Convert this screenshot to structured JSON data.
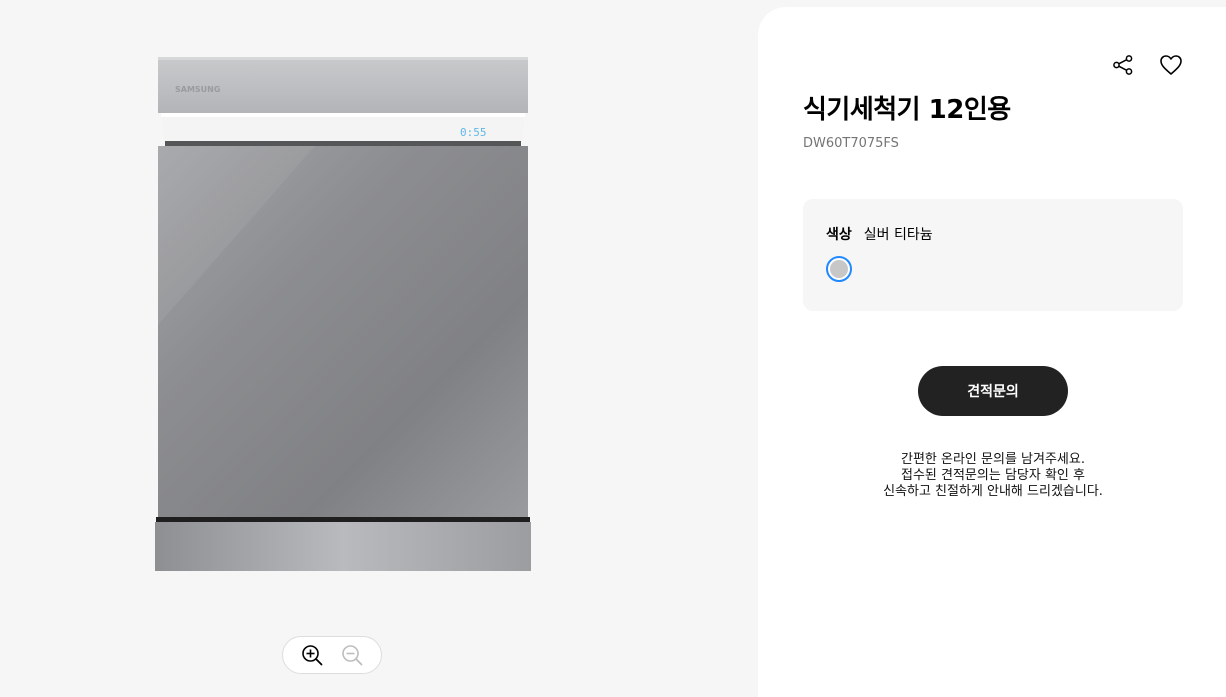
{
  "gallery": {
    "product_image": {
      "brand_text": "SAMSUNG",
      "display_text": "0:55"
    },
    "zoom": {
      "zoom_in_icon": "zoom-in-icon",
      "zoom_out_icon": "zoom-out-icon"
    }
  },
  "panel": {
    "actions": {
      "share_icon": "share-icon",
      "wishlist_icon": "heart-icon"
    },
    "title": "식기세척기 12인용",
    "model_code": "DW60T7075FS",
    "color_option": {
      "label": "색상",
      "value": "실버 티타늄",
      "swatches": [
        {
          "name": "실버 티타늄",
          "color": "#c7c7c7",
          "selected": true
        }
      ]
    },
    "cta_label": "견적문의",
    "notice_lines": [
      "간편한 온라인 문의를 남겨주세요.",
      "접수된 견적문의는 담당자 확인 후",
      "신속하고 친절하게 안내해 드리겠습니다."
    ]
  },
  "colors": {
    "accent_selected": "#2189ff",
    "cta_background": "#222222",
    "page_background": "#f6f6f6"
  }
}
